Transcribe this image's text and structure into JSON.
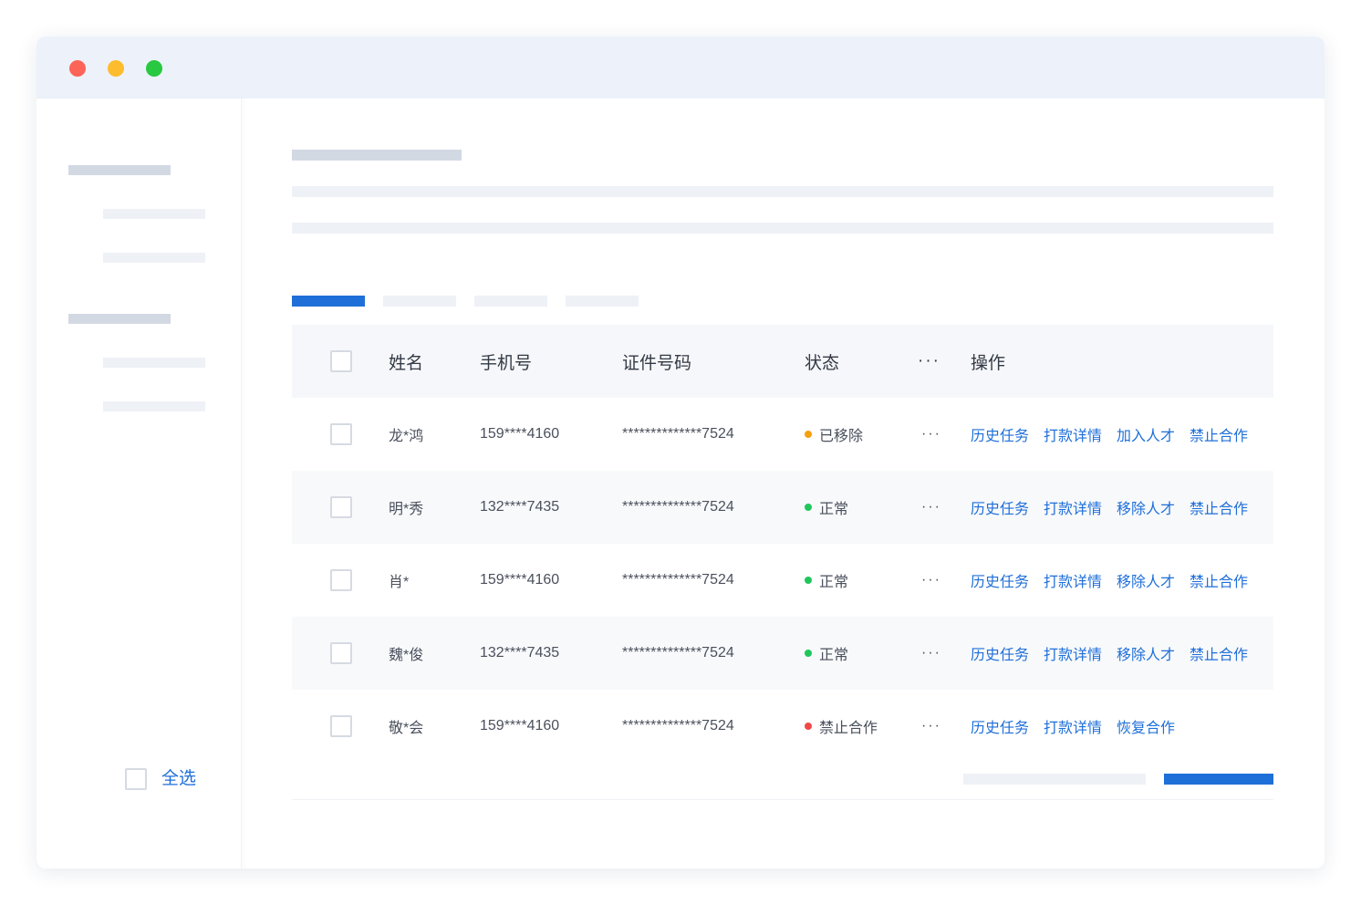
{
  "window": {
    "traffic_lights": {
      "close_color": "#fd6458",
      "minimize_color": "#fdbc2e",
      "maximize_color": "#28c840"
    }
  },
  "colors": {
    "accent": "#1f6fd9",
    "status_removed": "#f5a00c",
    "status_normal": "#1fc75b",
    "status_banned": "#f04848"
  },
  "table": {
    "headers": {
      "name": "姓名",
      "phone": "手机号",
      "id_number": "证件号码",
      "status": "状态",
      "more": "···",
      "actions": "操作"
    },
    "rows": [
      {
        "name": "龙*鸿",
        "phone": "159****4160",
        "id_number": "**************7524",
        "status": "已移除",
        "status_color": "#f5a00c",
        "more": "···",
        "actions": [
          "历史任务",
          "打款详情",
          "加入人才",
          "禁止合作"
        ]
      },
      {
        "name": "明*秀",
        "phone": "132****7435",
        "id_number": "**************7524",
        "status": "正常",
        "status_color": "#1fc75b",
        "more": "···",
        "actions": [
          "历史任务",
          "打款详情",
          "移除人才",
          "禁止合作"
        ]
      },
      {
        "name": "肖*",
        "phone": "159****4160",
        "id_number": "**************7524",
        "status": "正常",
        "status_color": "#1fc75b",
        "more": "···",
        "actions": [
          "历史任务",
          "打款详情",
          "移除人才",
          "禁止合作"
        ]
      },
      {
        "name": "魏*俊",
        "phone": "132****7435",
        "id_number": "**************7524",
        "status": "正常",
        "status_color": "#1fc75b",
        "more": "···",
        "actions": [
          "历史任务",
          "打款详情",
          "移除人才",
          "禁止合作"
        ]
      },
      {
        "name": "敬*会",
        "phone": "159****4160",
        "id_number": "**************7524",
        "status": "禁止合作",
        "status_color": "#f04848",
        "more": "···",
        "actions": [
          "历史任务",
          "打款详情",
          "恢复合作"
        ]
      }
    ]
  },
  "footer": {
    "select_all_label": "全选"
  }
}
